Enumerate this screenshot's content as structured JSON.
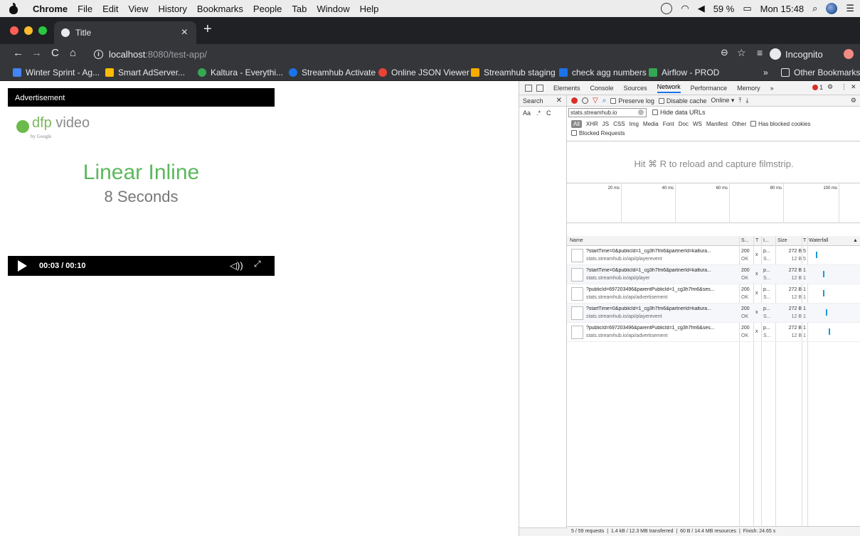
{
  "menubar": {
    "app": "Chrome",
    "items": [
      "File",
      "Edit",
      "View",
      "History",
      "Bookmarks",
      "People",
      "Tab",
      "Window",
      "Help"
    ],
    "battery": "59 %",
    "clock": "Mon 15:48"
  },
  "tabstrip": {
    "tab_title": "Title",
    "close_glyph": "×",
    "new_tab_glyph": "+"
  },
  "toolbar": {
    "back": "←",
    "forward": "→",
    "reload": "C",
    "home": "⌂",
    "url_host": "localhost",
    "url_rest": ":8080/test-app/",
    "zoom": "⊖",
    "star": "☆",
    "reading": "≡",
    "incognito_label": "Incognito"
  },
  "bookmarks": {
    "items": [
      {
        "label": "Winter Sprint - Ag...",
        "color": "#4285f4"
      },
      {
        "label": "Smart AdServer...",
        "color": "#fbbc04"
      },
      {
        "label": "Kaltura - Everythi...",
        "color": "#34a853"
      },
      {
        "label": "Streamhub Activate",
        "color": "#1a73e8"
      },
      {
        "label": "Online JSON Viewer",
        "color": "#ea4335"
      },
      {
        "label": "Streamhub staging",
        "color": "#f9ab00"
      },
      {
        "label": "check agg numbers",
        "color": "#1a73e8"
      },
      {
        "label": "Airflow - PROD",
        "color": "#34a853"
      }
    ],
    "overflow": "»",
    "other": "Other Bookmarks"
  },
  "player": {
    "ad_label": "Advertisement",
    "logo_dfp": "dfp",
    "logo_video": " video",
    "logo_by": "by Google",
    "title": "Linear Inline",
    "subtitle": "8 Seconds",
    "time": "00:03 / 00:10",
    "volume_glyph": "◁))",
    "fullscreen_glyph": "⤢"
  },
  "devtools": {
    "tabs": [
      "Elements",
      "Console",
      "Sources",
      "Network",
      "Performance",
      "Memory",
      "»"
    ],
    "active_tab": "Network",
    "error_count": "1",
    "search_label": "Search",
    "search_opts": [
      "Aa",
      ".*",
      "C"
    ],
    "preserve_log": "Preserve log",
    "disable_cache": "Disable cache",
    "throttle": "Online",
    "filter_value": "stats.streamhub.io",
    "hide_data_urls": "Hide data URLs",
    "types": [
      "All",
      "XHR",
      "JS",
      "CSS",
      "Img",
      "Media",
      "Font",
      "Doc",
      "WS",
      "Manifest",
      "Other"
    ],
    "has_blocked": "Has blocked cookies",
    "blocked_requests": "Blocked Requests",
    "filmstrip_hint": "Hit ⌘ R to reload and capture filmstrip.",
    "timeline_ticks": [
      "20 ms",
      "40 ms",
      "60 ms",
      "80 ms",
      "100 ms"
    ],
    "columns": [
      "Name",
      "S...",
      "T",
      "I...",
      "Size",
      "T",
      "Waterfall"
    ],
    "rows": [
      {
        "name": "?startTime=0&publicId=1_cg3h7fm6&partnerId=kaltura...",
        "path": "stats.streamhub.io/api/playerevent",
        "status": "200",
        "status_text": "OK",
        "type": "x",
        "init1": "p...",
        "init2": "S...",
        "size": "272 B",
        "res": "12 B",
        "t1": "5",
        "t2": "5",
        "wf": 0.1
      },
      {
        "name": "?startTime=0&publicId=1_cg3h7fm6&partnerId=kaltura...",
        "path": "stats.streamhub.io/api/player",
        "status": "200",
        "status_text": "OK",
        "type": "x",
        "init1": "p...",
        "init2": "S...",
        "size": "272 B",
        "res": "12 B",
        "t1": "1",
        "t2": "1",
        "wf": 0.27
      },
      {
        "name": "?publicId=697203496&parentPublicId=1_cg3h7fm6&ses...",
        "path": "stats.streamhub.io/api/advertisement",
        "status": "200",
        "status_text": "OK",
        "type": "x",
        "init1": "p...",
        "init2": "S...",
        "size": "272 B",
        "res": "12 B",
        "t1": "1",
        "t2": "1",
        "wf": 0.27
      },
      {
        "name": "?startTime=0&publicId=1_cg3h7fm6&partnerId=kaltura...",
        "path": "stats.streamhub.io/api/playerevent",
        "status": "200",
        "status_text": "OK",
        "type": "x",
        "init1": "p...",
        "init2": "S...",
        "size": "272 B",
        "res": "12 B",
        "t1": "1",
        "t2": "1",
        "wf": 0.33
      },
      {
        "name": "?publicId=697203496&parentPublicId=1_cg3h7fm6&ses...",
        "path": "stats.streamhub.io/api/advertisement",
        "status": "200",
        "status_text": "OK",
        "type": "x",
        "init1": "p...",
        "init2": "S...",
        "size": "272 B",
        "res": "12 B",
        "t1": "1",
        "t2": "1",
        "wf": 0.4
      }
    ],
    "status": {
      "requests": "5 / 59 requests",
      "transferred": "1.4 kB / 12.3 MB transferred",
      "resources": "60 B / 14.4 MB resources",
      "finish": "Finish: 24.65 s"
    }
  }
}
